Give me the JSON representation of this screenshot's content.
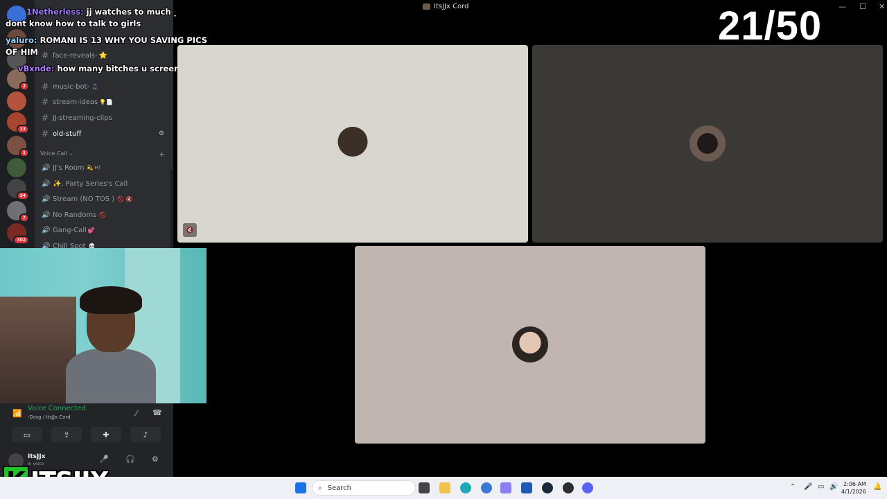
{
  "window": {
    "title": "ItsJJx Cord"
  },
  "counter": "21/50",
  "chat": [
    {
      "user": "1Netherless:",
      "message": "jj watches to much porn he dont know how to talk to girls"
    },
    {
      "user": "yaluro:",
      "message": "ROMANI IS 13 WHY YOU SAVING PICS OF HIM"
    },
    {
      "user": "vBxnde:",
      "message": "how many bitches u screenshotted"
    }
  ],
  "server_rail": {
    "badges": [
      "2",
      "13",
      "1",
      "34",
      "7",
      "302"
    ]
  },
  "channels": {
    "text": [
      {
        "name": "face-reveals-",
        "emoji": "⭐"
      },
      {
        "name": "music-bot-",
        "emoji": "♫"
      },
      {
        "name": "stream-ideas",
        "emoji": "💡📄"
      },
      {
        "name": "JJ-streaming-clips",
        "emoji": ""
      },
      {
        "name": "old-stuff",
        "emoji": ""
      }
    ],
    "voice_category": "Voice Call",
    "voice": [
      {
        "name": "JJ's Room",
        "emoji": "💫 HT"
      },
      {
        "name": "✨. Party Series's Call",
        "emoji": ""
      },
      {
        "name": "Stream (NO TOS )",
        "emoji": "🚫 🔇"
      },
      {
        "name": "No Randoms",
        "emoji": "🚫"
      },
      {
        "name": "Gang-Call",
        "emoji": "💕"
      },
      {
        "name": "Chill Spot",
        "emoji": "💀"
      }
    ]
  },
  "voice_panel": {
    "status": "Voice Connected",
    "subtitle": "-Drag / ItsJJx Cord"
  },
  "user": {
    "name": "ItsJJx",
    "status": "In voice"
  },
  "logo": {
    "letter": "K",
    "name": "ITSJJX"
  },
  "tiles": [
    {
      "bg": "#d9d6cf"
    },
    {
      "bg": "#3a3936"
    },
    {
      "bg": "#c0b5b1"
    }
  ],
  "taskbar": {
    "search_label": "Search",
    "time": "2:06 AM",
    "date": "4/1/2026"
  },
  "colors": {
    "discord_bg": "#2b2d31",
    "rail_bg": "#1e1f22",
    "voice_connected": "#23a55a",
    "badge_red": "#da373c",
    "logo_green": "#22c22a"
  }
}
